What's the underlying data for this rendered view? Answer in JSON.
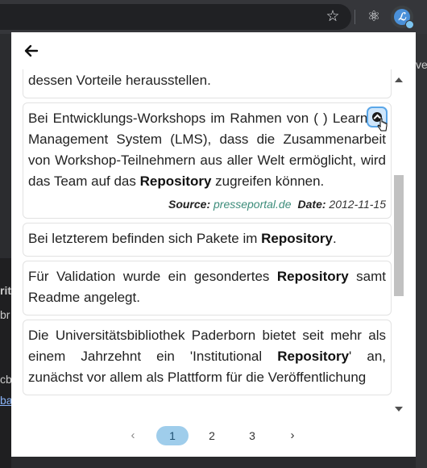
{
  "browser": {
    "star_icon": "star-icon",
    "extensions": [
      "react-devtools-icon",
      "linguee-extension-icon"
    ],
    "bg_fragments": [
      "ve",
      "rit",
      "br",
      "cb",
      "ba"
    ]
  },
  "popup": {
    "back_icon": "arrow-left-icon",
    "cards": [
      {
        "parts": [
          {
            "t": "Softwarekomponenten an und wollte damit offenbar dessen Vorteile herausstellen.",
            "b": false
          }
        ]
      },
      {
        "parts": [
          {
            "t": "Bei Entwicklungs-Workshops im Rahmen von ( ) Learning Management System (LMS), dass die Zusammenarbeit von Workshop-Teilnehmern aus aller Welt ermöglicht, wird das Team auf das ",
            "b": false
          },
          {
            "t": "Repository",
            "b": true
          },
          {
            "t": " zugreifen können.",
            "b": false
          }
        ],
        "source_label": "Source:",
        "source": "presseportal.de",
        "date_label": "Date:",
        "date": "2012-11-15",
        "expand_icon": "chevron-up-icon"
      },
      {
        "parts": [
          {
            "t": "Bei letzterem befinden sich Pakete im ",
            "b": false
          },
          {
            "t": "Repository",
            "b": true
          },
          {
            "t": ".",
            "b": false
          }
        ]
      },
      {
        "parts": [
          {
            "t": "Für Validation wurde ein gesondertes ",
            "b": false
          },
          {
            "t": "Repository",
            "b": true
          },
          {
            "t": " samt Readme angelegt.",
            "b": false
          }
        ]
      },
      {
        "parts": [
          {
            "t": "Die Universitätsbibliothek Paderborn bietet seit mehr als einem Jahrzehnt ein 'Institutional ",
            "b": false
          },
          {
            "t": "Repository",
            "b": true
          },
          {
            "t": "' an, zunächst vor allem als Plattform für die Veröffentlichung",
            "b": false
          }
        ]
      }
    ],
    "scroll_fraction": 0.35
  },
  "pagination": {
    "prev": "‹",
    "next": "›",
    "pages": [
      "1",
      "2",
      "3"
    ],
    "active": "1"
  }
}
